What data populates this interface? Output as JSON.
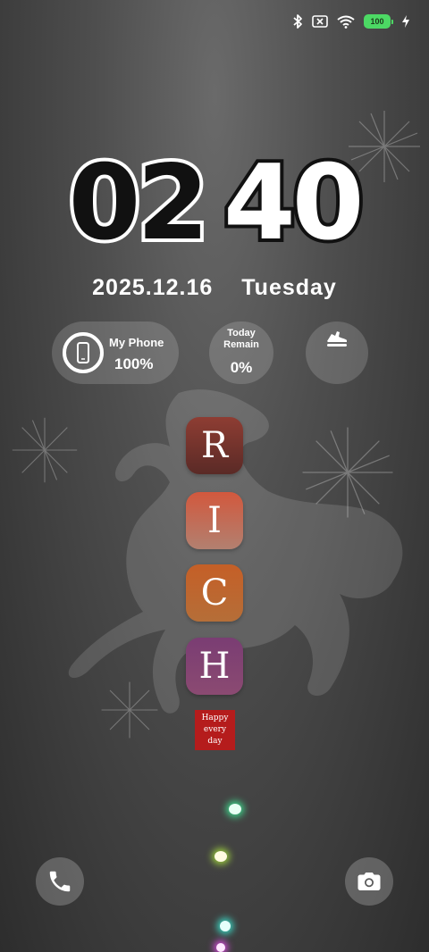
{
  "status_bar": {
    "icons": [
      "bluetooth-icon",
      "no-sim-icon",
      "wifi-icon",
      "battery-icon",
      "charging-bolt-icon"
    ],
    "battery_level": "100",
    "accent": "#4cd964"
  },
  "lockscreen": {
    "clock": {
      "hours": "02",
      "minutes": "40"
    },
    "date": "2025.12.16",
    "weekday": "Tuesday"
  },
  "widgets": {
    "phone": {
      "name": "My Phone",
      "battery": "100%",
      "battery_fraction": 1.0
    },
    "today": {
      "label": "Today\nRemain",
      "value": "0%"
    },
    "steps": {
      "icon": "running-shoe-icon"
    }
  },
  "rich_tiles": [
    {
      "letter": "R",
      "color": "#7a3530"
    },
    {
      "letter": "I",
      "color": "#c4664a"
    },
    {
      "letter": "C",
      "color": "#c26530"
    },
    {
      "letter": "H",
      "color": "#7e4270"
    }
  ],
  "stamp": {
    "text": "Happy\nevery\nday",
    "color": "#b51c1c"
  },
  "shortcuts": {
    "left_icon": "phone-icon",
    "right_icon": "camera-icon"
  }
}
